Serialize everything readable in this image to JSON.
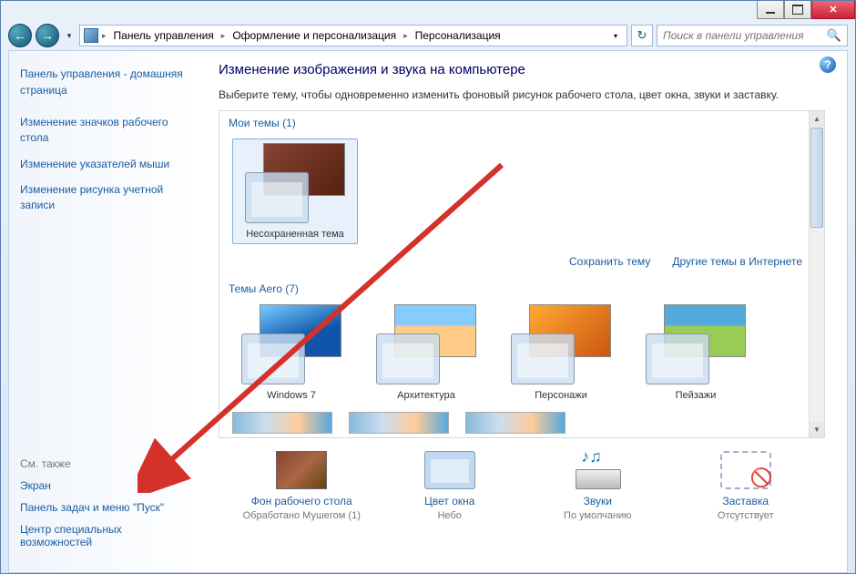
{
  "breadcrumb": {
    "items": [
      "Панель управления",
      "Оформление и персонализация",
      "Персонализация"
    ]
  },
  "search": {
    "placeholder": "Поиск в панели управления"
  },
  "sidebar": {
    "home": "Панель управления - домашняя страница",
    "links": [
      "Изменение значков рабочего стола",
      "Изменение указателей мыши",
      "Изменение рисунка учетной записи"
    ],
    "see_also_title": "См. также",
    "see_also": [
      "Экран",
      "Панель задач и меню \"Пуск\"",
      "Центр специальных возможностей"
    ]
  },
  "main": {
    "title": "Изменение изображения и звука на компьютере",
    "desc": "Выберите тему, чтобы одновременно изменить фоновый рисунок рабочего стола, цвет окна, звуки и заставку.",
    "my_themes_title": "Мои темы (1)",
    "my_themes": [
      {
        "name": "Несохраненная тема"
      }
    ],
    "save_theme": "Сохранить тему",
    "more_themes": "Другие темы в Интернете",
    "aero_title": "Темы Aero (7)",
    "aero_themes": [
      {
        "name": "Windows 7"
      },
      {
        "name": "Архитектура"
      },
      {
        "name": "Персонажи"
      },
      {
        "name": "Пейзажи"
      }
    ]
  },
  "bottom": {
    "items": [
      {
        "label": "Фон рабочего стола",
        "value": "Обработано Мушегом (1)"
      },
      {
        "label": "Цвет окна",
        "value": "Небо"
      },
      {
        "label": "Звуки",
        "value": "По умолчанию"
      },
      {
        "label": "Заставка",
        "value": "Отсутствует"
      }
    ]
  }
}
